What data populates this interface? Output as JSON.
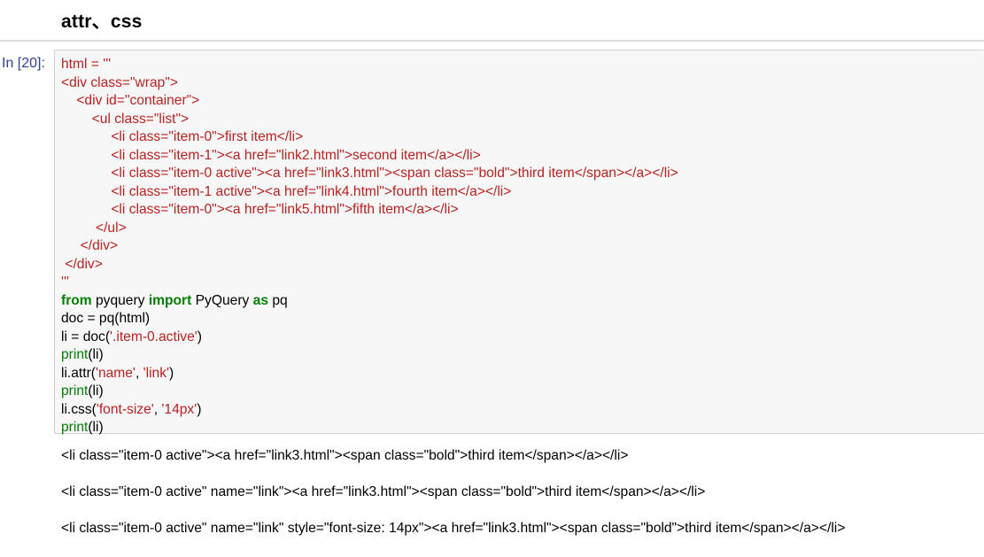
{
  "section_heading": "attr、css",
  "cell": {
    "prompt": "In [20]:",
    "code_lines": [
      [
        {
          "t": "s",
          "v": "html = '''"
        }
      ],
      [
        {
          "t": "s",
          "v": "<div class=\"wrap\">"
        }
      ],
      [
        {
          "t": "s",
          "v": "    <div id=\"container\">"
        }
      ],
      [
        {
          "t": "s",
          "v": "        <ul class=\"list\">"
        }
      ],
      [
        {
          "t": "s",
          "v": "             <li class=\"item-0\">first item</li>"
        }
      ],
      [
        {
          "t": "s",
          "v": "             <li class=\"item-1\"><a href=\"link2.html\">second item</a></li>"
        }
      ],
      [
        {
          "t": "s",
          "v": "             <li class=\"item-0 active\"><a href=\"link3.html\"><span class=\"bold\">third item</span></a></li>"
        }
      ],
      [
        {
          "t": "s",
          "v": "             <li class=\"item-1 active\"><a href=\"link4.html\">fourth item</a></li>"
        }
      ],
      [
        {
          "t": "s",
          "v": "             <li class=\"item-0\"><a href=\"link5.html\">fifth item</a></li>"
        }
      ],
      [
        {
          "t": "s",
          "v": "         </ul>"
        }
      ],
      [
        {
          "t": "s",
          "v": "     </div>"
        }
      ],
      [
        {
          "t": "s",
          "v": " </div>"
        }
      ],
      [
        {
          "t": "s",
          "v": "'''"
        }
      ],
      [
        {
          "t": "k",
          "v": "from"
        },
        {
          "t": "t",
          "v": " pyquery "
        },
        {
          "t": "k",
          "v": "import"
        },
        {
          "t": "t",
          "v": " PyQuery "
        },
        {
          "t": "k",
          "v": "as"
        },
        {
          "t": "t",
          "v": " pq"
        }
      ],
      [
        {
          "t": "t",
          "v": "doc = pq(html)"
        }
      ],
      [
        {
          "t": "t",
          "v": "li = doc("
        },
        {
          "t": "s",
          "v": "'.item-0.active'"
        },
        {
          "t": "t",
          "v": ")"
        }
      ],
      [
        {
          "t": "b",
          "v": "print"
        },
        {
          "t": "t",
          "v": "(li)"
        }
      ],
      [
        {
          "t": "t",
          "v": "li.attr("
        },
        {
          "t": "s",
          "v": "'name'"
        },
        {
          "t": "t",
          "v": ", "
        },
        {
          "t": "s",
          "v": "'link'"
        },
        {
          "t": "t",
          "v": ")"
        }
      ],
      [
        {
          "t": "b",
          "v": "print"
        },
        {
          "t": "t",
          "v": "(li)"
        }
      ],
      [
        {
          "t": "t",
          "v": "li.css("
        },
        {
          "t": "s",
          "v": "'font-size'"
        },
        {
          "t": "t",
          "v": ", "
        },
        {
          "t": "s",
          "v": "'14px'"
        },
        {
          "t": "t",
          "v": ")"
        }
      ],
      [
        {
          "t": "b",
          "v": "print"
        },
        {
          "t": "t",
          "v": "(li)"
        }
      ]
    ],
    "output_lines": [
      "<li class=\"item-0 active\"><a href=\"link3.html\"><span class=\"bold\">third item</span></a></li>",
      "<li class=\"item-0 active\" name=\"link\"><a href=\"link3.html\"><span class=\"bold\">third item</span></a></li>",
      "<li class=\"item-0 active\" name=\"link\" style=\"font-size: 14px\"><a href=\"link3.html\"><span class=\"bold\">third item</span></a></li>"
    ]
  },
  "colors": {
    "keyword": "#008000",
    "string": "#ba2121",
    "prompt": "#303f9f",
    "cell_background": "#f7f7f7"
  }
}
